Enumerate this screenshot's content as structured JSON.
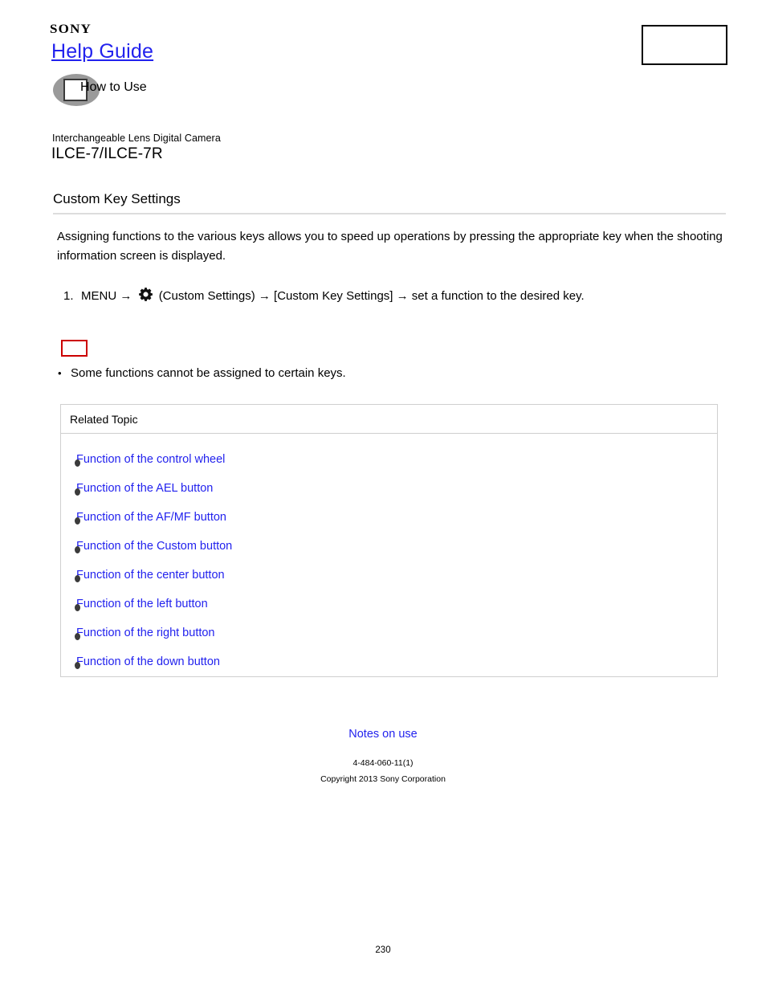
{
  "header": {
    "brand": "SONY",
    "site_title": "Help Guide",
    "howto_label": "How to Use",
    "howto_icon": "book-circle-icon",
    "top_right_box": ""
  },
  "product": {
    "category": "Interchangeable Lens Digital Camera",
    "model": "ILCE-7/ILCE-7R"
  },
  "page": {
    "title": "Custom Key Settings",
    "intro": "Assigning functions to the various keys allows you to speed up operations by pressing the appropriate key when the shooting information screen is displayed.",
    "number": "230"
  },
  "steps": [
    {
      "number": "1.",
      "before_icon": "MENU →",
      "icon": "gear-icon",
      "after_icon": "(Custom Settings) → [Custom Key Settings] → set a function to the desired key."
    }
  ],
  "note": {
    "box_label": "",
    "bullet_marker": "•",
    "items": [
      "Some functions cannot be assigned to certain keys."
    ]
  },
  "related_topic": {
    "header": "Related Topic",
    "links": [
      "Function of the control wheel",
      "Function of the AEL button",
      "Function of the AF/MF button",
      "Function of the Custom button",
      "Function of the center button",
      "Function of the left button",
      "Function of the right button",
      "Function of the down button"
    ]
  },
  "footer": {
    "notes_on_use": "Notes on use",
    "doc_number": "4-484-060-11(1)",
    "copyright": "Copyright 2013 Sony Corporation"
  },
  "colors": {
    "link_blue": "#2222ee",
    "note_red": "#cc0000",
    "rule_gray": "#dddddd",
    "panel_border": "#cfcfcf",
    "icon_gray": "#9a9a9a"
  }
}
